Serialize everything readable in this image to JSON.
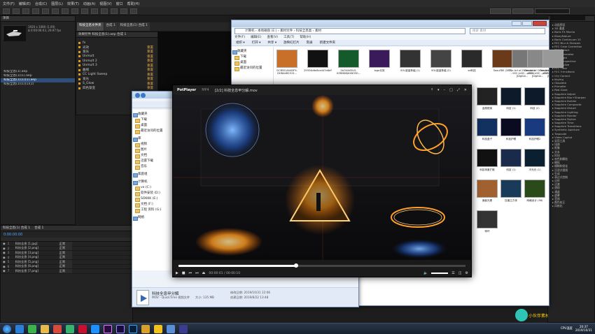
{
  "ae": {
    "menus": [
      "文件(F)",
      "编辑(E)",
      "合成(C)",
      "图层(L)",
      "效果(T)",
      "动画(A)",
      "视图(V)",
      "窗口",
      "帮助(H)"
    ],
    "workspace_tabs": [
      {
        "label": "科技全息文件夹",
        "active": true
      },
      {
        "label": "合成 1"
      },
      {
        "label": "科技全息(1) 合成 1"
      }
    ],
    "project": {
      "title": "项目",
      "meta_lines": [
        "1920 x 1080 (1.00)",
        "Δ 0:00:06:03, 29.97 fps"
      ],
      "rows": [
        {
          "label": "科技全息(1).aep",
          "selected": false
        },
        {
          "label": "科技全息(1)(1).aep",
          "selected": false
        },
        {
          "label": "科技全息(1)(1)(1).aep",
          "selected": true
        },
        {
          "label": "科技全息(1)(1)(1)(1)",
          "selected": false
        }
      ]
    },
    "effects_controls": {
      "title": "效果控件 科技全息(1).aep 合成 1",
      "rows": [
        {
          "name": "fx",
          "value": ""
        },
        {
          "name": "光效",
          "value": "重置"
        },
        {
          "name": "发光",
          "value": "重置"
        },
        {
          "name": "Unmult",
          "value": "重置"
        },
        {
          "name": "Unmult 2",
          "value": "重置"
        },
        {
          "name": "Unmult 3",
          "value": "重置"
        },
        {
          "name": "曲线",
          "value": "重置"
        },
        {
          "name": "CC Light Sweep",
          "value": "重置"
        },
        {
          "name": "发光",
          "value": "重置"
        },
        {
          "name": "S_Glow",
          "value": "重置"
        },
        {
          "name": "四色渐变",
          "value": "重置"
        }
      ]
    },
    "timeline": {
      "tabs": [
        "科技全息(1) 合成 1",
        "合成 1"
      ],
      "time": "0:00:00:00",
      "rows": [
        {
          "num": "1",
          "name": "科技全息 [1.jpg]",
          "mode": "正常"
        },
        {
          "num": "2",
          "name": "科技全息 [2.png]",
          "mode": "正常"
        },
        {
          "num": "3",
          "name": "科技全息 [3.png]",
          "mode": "正常"
        },
        {
          "num": "4",
          "name": "科技全息 [4.png]",
          "mode": "正常"
        },
        {
          "num": "5",
          "name": "科技全息 [5.png]",
          "mode": "正常"
        },
        {
          "num": "6",
          "name": "科技全息 [6.png]",
          "mode": "正常"
        },
        {
          "num": "7",
          "name": "科技全息 [7.png]",
          "mode": "正常"
        }
      ]
    },
    "effects_presets": {
      "rows": [
        "动画预设",
        "3D 通道",
        "Boris FX Mocha",
        "BlueyNature",
        "Boris Continuum 10",
        "FEC Blur & Sharpen",
        "FEC Color Correction",
        "FEC Distort",
        "FEC Generator",
        "FEC Light",
        "FEC Perspective",
        "FEC Stylize",
        "FEC Time",
        "FEC Transitions",
        "Key Correct",
        "Keying",
        "Obsolete",
        "Primatte",
        "Red Giant",
        "Sapphire Adjust",
        "Sapphire Blur+Sharpen",
        "Sapphire Builder",
        "Sapphire Composite",
        "Sapphire Distort",
        "Sapphire Lighting",
        "Sapphire Render",
        "Sapphire Stylize",
        "Sapphire Time",
        "Sapphire Transitions",
        "Synthetic Aperture",
        "Trapcode",
        "Video Copilot",
        "实用工具",
        "扭曲",
        "抠像",
        "文本",
        "时间",
        "杂色和颗粒",
        "模拟",
        "模糊和锐化",
        "沉浸式视频",
        "生成",
        "表达式控制",
        "过时",
        "过渡",
        "透视",
        "通道",
        "遮罩",
        "音频",
        "颜色校正",
        "风格化"
      ]
    }
  },
  "explorer_back": {
    "address": "计算机 › 本地磁盘 (E:) › 素材文件 › 科技全息类 › 素材",
    "search_placeholder": "搜索 素材",
    "menus": [
      "文件(F)",
      "编辑(E)",
      "查看(V)",
      "工具(T)",
      "帮助(H)"
    ],
    "cmd": [
      "组织 ▾",
      "打开 ▾",
      "共享 ▾",
      "放映幻灯片",
      "刻录",
      "新建文件夹"
    ],
    "nav": [
      {
        "label": "收藏夹",
        "head": true
      },
      {
        "label": "下载"
      },
      {
        "label": "桌面"
      },
      {
        "label": "最近访问的位置"
      }
    ],
    "files": [
      {
        "label": "0C3B51A04DF9-DHBA4B2515..."
      },
      {
        "label": "25924b6e8ce447a8d9b8e36e4bae75334e609D49A8048A3"
      },
      {
        "label": "2b7A4VDVG-XZ8ND8JX4N33G..."
      },
      {
        "label": "logo光效"
      },
      {
        "label": "SOL能量条幅 (1)"
      },
      {
        "label": "SOL能量条幅 (2)"
      },
      {
        "label": "sd科技"
      },
      {
        "label": "SaouFBS (287)"
      },
      {
        "label": "The Art of Overwatch - 002 (s00) - p074 [Digital..."
      },
      {
        "label": "The Art of Overwatch - 002 (s00) - p075 [Digital..."
      },
      {
        "label": "The Art of Overwatch - 002 (s00) - p097 [Digital..."
      },
      {
        "label": "金属框架"
      },
      {
        "label": "科技 (1)"
      },
      {
        "label": "科技 (2)"
      },
      {
        "label": "科技盒子"
      },
      {
        "label": "科技护眼"
      },
      {
        "label": "科技护眼2"
      },
      {
        "label": "科技场景扩散"
      },
      {
        "label": "科技 (1)"
      },
      {
        "label": "冷光光 (1)"
      },
      {
        "label": "面板光晕"
      },
      {
        "label": "压缩立方体"
      },
      {
        "label": "网格设计 (58)"
      },
      {
        "label": "球环"
      }
    ]
  },
  "explorer_front": {
    "nav": [
      {
        "label": "收藏夹",
        "head": true
      },
      {
        "label": "下载"
      },
      {
        "label": "桌面"
      },
      {
        "label": "最近访问的位置"
      },
      {
        "label": "库",
        "head": true
      },
      {
        "label": "视频"
      },
      {
        "label": "图片"
      },
      {
        "label": "文档"
      },
      {
        "label": "迅雷下载"
      },
      {
        "label": "音乐"
      },
      {
        "label": "家庭组",
        "head": true
      },
      {
        "label": "计算机",
        "head": true
      },
      {
        "label": "ve (C:)"
      },
      {
        "label": "软件安装 (D:)"
      },
      {
        "label": "SOKKK (E:)"
      },
      {
        "label": "文档 (F:)"
      },
      {
        "label": "工程 资料 (G:)"
      },
      {
        "label": "网络",
        "head": true
      }
    ],
    "details": {
      "name": "科技全息甲分解",
      "type": "MOV - QuickTime 视频文件",
      "size_label": "大小: 135 MB",
      "modified": "修改日期: 2019/10/31 22:06",
      "created": "创建日期: 2019/8/22 13:48"
    }
  },
  "potplayer": {
    "logo": "PotPlayer",
    "format": "MP4",
    "title": "[2/2] 科技全息甲分解.mov",
    "time": "00:00:01 / 00:00:10",
    "progress": 0.41
  },
  "taskbar": {
    "clock_time": "20:37",
    "clock_date": "2019/10/31",
    "tray_text": "CPU温度",
    "watermark": "小伙伴素材"
  }
}
